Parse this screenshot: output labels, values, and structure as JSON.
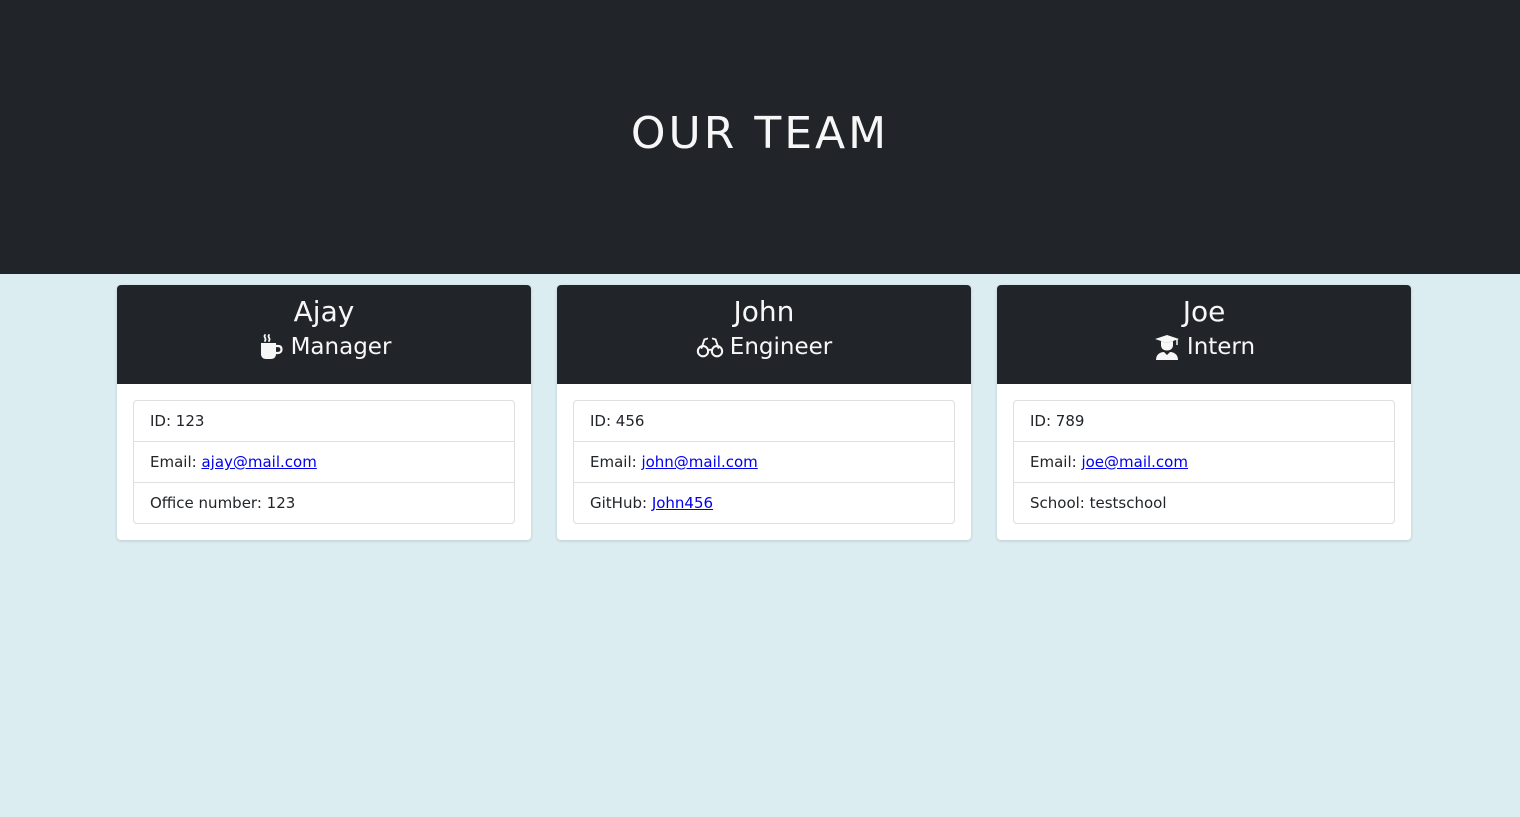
{
  "header": {
    "title": "OUR TEAM"
  },
  "team": [
    {
      "name": "Ajay",
      "role": "Manager",
      "role_icon": "coffee-mug-icon",
      "id_label": "ID: ",
      "id": "123",
      "email_label": "Email: ",
      "email": "ajay@mail.com",
      "extra_label": "Office number: ",
      "extra_value": "123"
    },
    {
      "name": "John",
      "role": "Engineer",
      "role_icon": "glasses-icon",
      "id_label": "ID: ",
      "id": "456",
      "email_label": "Email: ",
      "email": "john@mail.com",
      "extra_label": "GitHub: ",
      "extra_value": "John456"
    },
    {
      "name": "Joe",
      "role": "Intern",
      "role_icon": "graduate-icon",
      "id_label": "ID: ",
      "id": "789",
      "email_label": "Email: ",
      "email": "joe@mail.com",
      "extra_label": "School: ",
      "extra_value": "testschool"
    }
  ],
  "colors": {
    "page_background": "#dbedf1",
    "header_background": "#212529",
    "link": "#0000ee"
  }
}
